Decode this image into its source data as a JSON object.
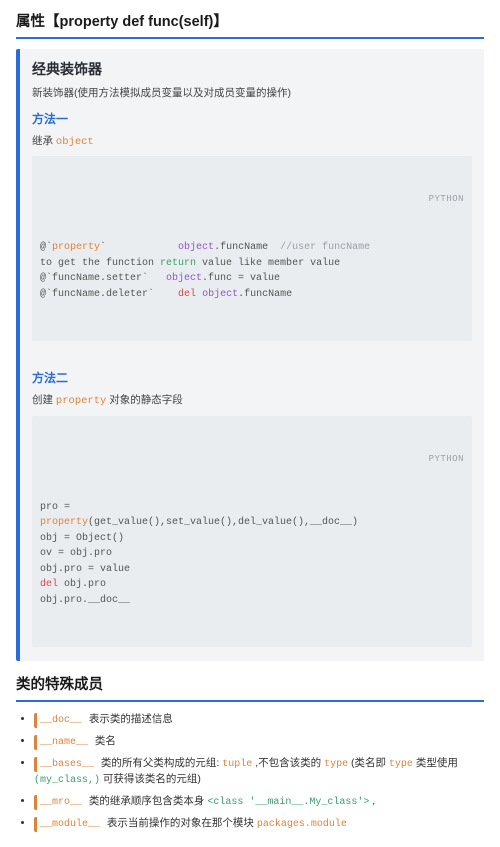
{
  "section1": {
    "title": "属性【property def func(self)】",
    "block": {
      "header": "经典装饰器",
      "desc": "新装饰器(使用方法模拟成员变量以及对成员变量的操作)"
    },
    "method1": {
      "label": "方法一",
      "inherit_prefix": "继承 ",
      "inherit_kw": "object",
      "code_lang": "PYTHON",
      "code_tokens": [
        [
          "@`",
          "property",
          "`            ",
          "object",
          ".funcName ",
          " //user funcName"
        ],
        [
          "to get the function ",
          "return",
          " value like member value"
        ],
        [
          "@`funcName.setter`   ",
          "object",
          ".func = value"
        ],
        [
          "@`funcName.deleter`    ",
          "del",
          " ",
          "object",
          ".funcName"
        ]
      ],
      "code_classes": [
        [
          "",
          "tk-orange",
          "",
          "tk-purple",
          "",
          "tk-comment"
        ],
        [
          "",
          "tk-green",
          ""
        ],
        [
          "",
          "tk-purple",
          ""
        ],
        [
          "",
          "tk-red",
          "",
          "tk-purple",
          ""
        ]
      ]
    },
    "method2": {
      "label": "方法二",
      "create_prefix": "创建 ",
      "create_kw": "property",
      "create_suffix": " 对象的静态字段",
      "code_lang": "PYTHON",
      "code_tokens": [
        [
          "pro ="
        ],
        [
          "property",
          "(get_value(),set_value(),del_value(),__doc__)"
        ],
        [
          "obj = Object()"
        ],
        [
          "ov = obj.pro"
        ],
        [
          "obj.pro = value"
        ],
        [
          "del",
          " obj.pro"
        ],
        [
          "obj.pro.__doc__"
        ]
      ],
      "code_classes": [
        [
          ""
        ],
        [
          "tk-orange",
          ""
        ],
        [
          ""
        ],
        [
          ""
        ],
        [
          ""
        ],
        [
          "tk-red",
          ""
        ],
        [
          ""
        ]
      ]
    }
  },
  "section2": {
    "title": "类的特殊成员",
    "items": [
      {
        "tag": "__doc__",
        "parts": [
          {
            "text": " 表示类的描述信息"
          }
        ]
      },
      {
        "tag": "__name__",
        "parts": [
          {
            "text": " 类名"
          }
        ]
      },
      {
        "tag": "__bases__",
        "parts": [
          {
            "text": " 类的所有父类构成的元组: "
          },
          {
            "text": "tuple",
            "cls": "c-orange inline-code"
          },
          {
            "text": " ,不包含该类的 "
          },
          {
            "text": "type",
            "cls": "c-orange inline-code"
          },
          {
            "text": " (类名即 "
          },
          {
            "text": "type",
            "cls": "c-orange inline-code"
          },
          {
            "text": " 类型使用 "
          },
          {
            "text": "(my_class,)",
            "cls": "c-green inline-code"
          },
          {
            "text": " 可获得该类名的元组)"
          }
        ]
      },
      {
        "tag": "__mro__",
        "parts": [
          {
            "text": " 类的继承顺序包含类本身 "
          },
          {
            "text": "<class '__main__.My_class'>",
            "cls": "c-green inline-code"
          },
          {
            "text": " ,"
          }
        ]
      },
      {
        "tag": "__module__",
        "parts": [
          {
            "text": " 表示当前操作的对象在那个模块 "
          },
          {
            "text": "packages.module",
            "cls": "c-orange inline-code"
          }
        ]
      }
    ]
  }
}
